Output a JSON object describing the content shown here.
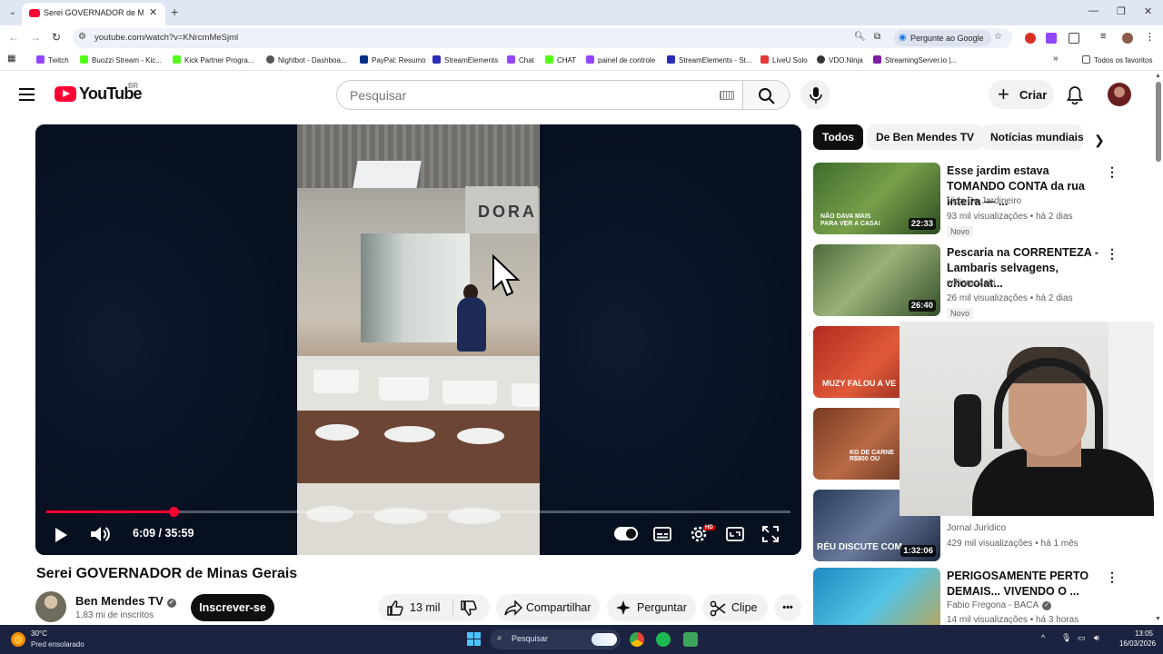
{
  "browser": {
    "tab_title": "Serei GOVERNADOR de Minas Gerais",
    "url": "youtube.com/watch?v=KNrcmMeSjml",
    "gemini_chip": "Pergunte ao Google",
    "bookmarks": [
      "Twitch",
      "Buozzi Stream - Kic...",
      "Kick Partner Progra...",
      "Nightbot - Dashboa...",
      "PayPal: Resumo",
      "StreamElements",
      "Chat",
      "CHAT",
      "painel de controle",
      "StreamElements - St...",
      "LiveU Solo",
      "VDO.Ninja",
      "StreamingServer.io |..."
    ],
    "all_bookmarks": "Todos os favoritos"
  },
  "yt_header": {
    "logo_text": "YouTube",
    "country": "BR",
    "search_placeholder": "Pesquisar",
    "create_label": "Criar"
  },
  "player": {
    "current_time": "6:09",
    "duration": "35:59",
    "time_display": "6:09 / 35:59",
    "progress_fraction": 0.171,
    "quality_badge": "HD",
    "store_sign": "DORA"
  },
  "video": {
    "title": "Serei GOVERNADOR de Minas Gerais",
    "channel": "Ben Mendes TV",
    "subscribers": "1,83 mi de inscritos",
    "subscribe_label": "Inscrever-se",
    "likes": "13 mil",
    "share_label": "Compartilhar",
    "ask_label": "Perguntar",
    "clip_label": "Clipe",
    "more_label": "•••"
  },
  "chips": [
    "Todos",
    "De Ben Mendes TV",
    "Notícias mundiais"
  ],
  "recommendations": [
    {
      "title": "Esse jardim estava TOMANDO CONTA da rua inteira — ...",
      "channel": "Vida De Jardineiro",
      "meta": "93 mil visualizações • há 2 dias",
      "badge": "Novo",
      "duration": "22:33",
      "thumb_text": "NÃO DAVA MAIS PARA VER A CASA!"
    },
    {
      "title": "Pescaria na CORRENTEZA - Lambaris selvagens, chocolat...",
      "channel": "williamozeki",
      "meta": "26 mil visualizações • há 2 dias",
      "badge": "Novo",
      "duration": "26:40",
      "thumb_text": ""
    },
    {
      "title": "",
      "channel": "",
      "meta": "",
      "badge": "",
      "duration": "",
      "thumb_text": "MUZY FALOU A VE"
    },
    {
      "title": "",
      "channel": "",
      "meta": "",
      "badge": "",
      "duration": "",
      "thumb_text": "KG DE CARNE R$800 OU"
    },
    {
      "title": "",
      "channel": "Jornal Jurídico",
      "meta": "429 mil visualizações • há 1 mês",
      "badge": "",
      "duration": "1:32:06",
      "thumb_text": "RÉU DISCUTE COM"
    },
    {
      "title": "PERIGOSAMENTE PERTO DEMAIS... VIVENDO O ...",
      "channel": "Fabio Fregona - BACA",
      "meta": "14 mil visualizações • há 3 horas",
      "badge": "",
      "duration": "",
      "thumb_text": ""
    }
  ],
  "taskbar": {
    "temperature": "30°C",
    "weather": "Pred ensolarado",
    "search_placeholder": "Pesquisar",
    "time": "13:05",
    "date": "16/03/2026"
  }
}
